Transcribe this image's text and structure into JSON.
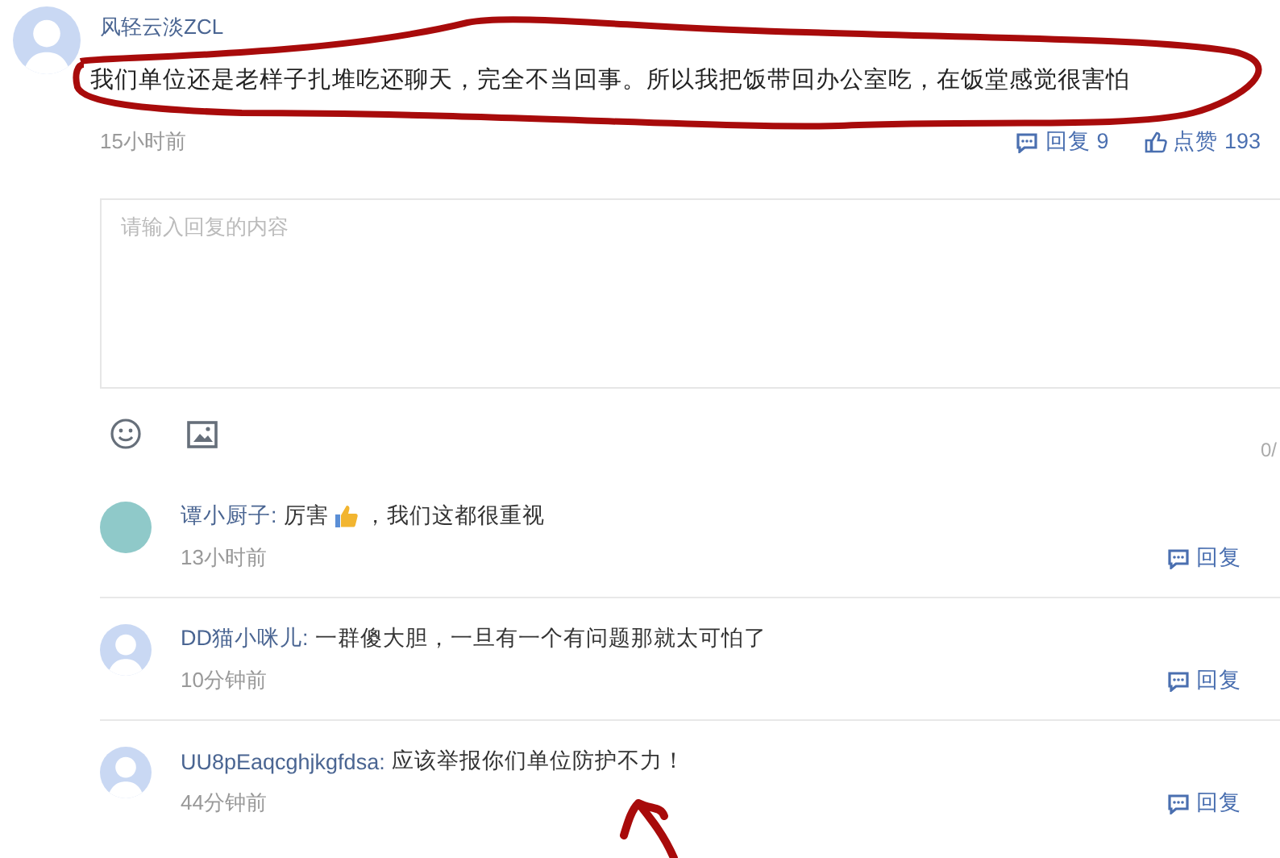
{
  "comment": {
    "user": "风轻云淡ZCL",
    "text": "我们单位还是老样子扎堆吃还聊天，完全不当回事。所以我把饭带回办公室吃，在饭堂感觉很害怕",
    "time": "15小时前",
    "reply_label": "回复 9",
    "like_label": "点赞 193"
  },
  "reply_box": {
    "placeholder": "请输入回复的内容",
    "counter": "0/"
  },
  "replies": [
    {
      "user": "谭小厨子:",
      "has_photo": true,
      "text": "厉害",
      "thumb": true,
      "text_after": "，我们这都很重视",
      "time": "13小时前",
      "reply_label": "回复"
    },
    {
      "user": "DD猫小咪儿:",
      "has_photo": false,
      "text": "一群傻大胆，一旦有一个有问题那就太可怕了",
      "thumb": false,
      "time": "10分钟前",
      "reply_label": "回复"
    },
    {
      "user": "UU8pEaqcghjkgfdsa:",
      "has_photo": false,
      "text": "应该举报你们单位防护不力！",
      "thumb": false,
      "time": "44分钟前",
      "reply_label": "回复"
    }
  ]
}
